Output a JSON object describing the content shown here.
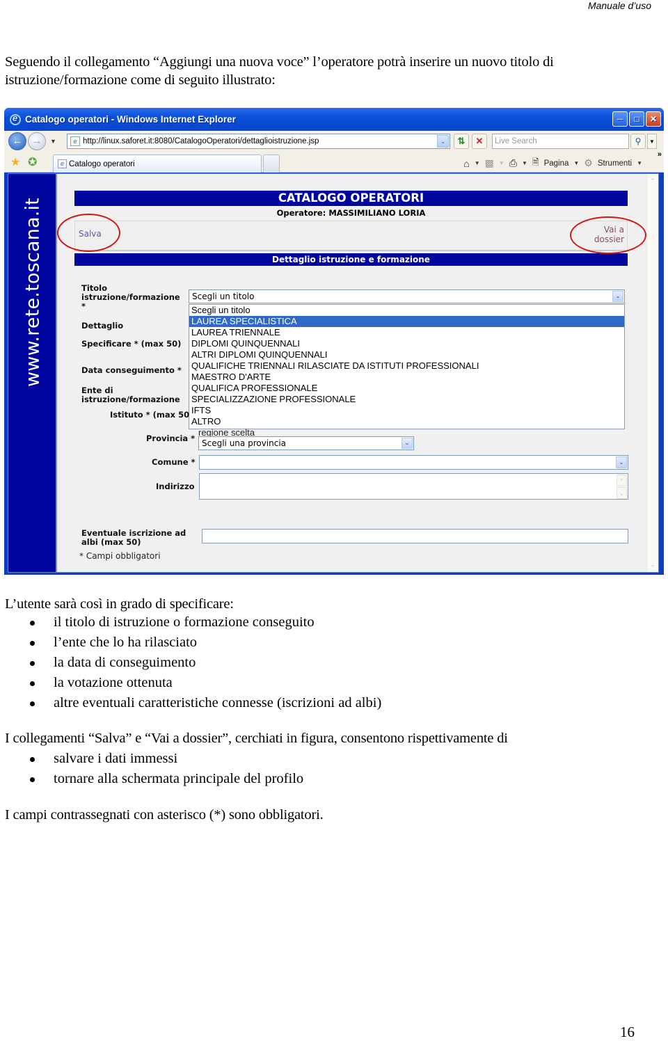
{
  "header": {
    "running_title": "Manuale d’uso"
  },
  "intro_text": "Seguendo il collegamento “Aggiungi una nuova voce” l’operatore potrà inserire un nuovo titolo di istruzione/formazione come di seguito illustrato:",
  "browser": {
    "window_title": "Catalogo operatori - Windows Internet Explorer",
    "address": "http://linux.saforet.it:8080/CatalogoOperatori/dettaglioistruzione.jsp",
    "search_placeholder": "Live Search",
    "tab_label": "Catalogo operatori",
    "command_bar": {
      "page_label": "Pagina",
      "tools_label": "Strumenti"
    },
    "icons": [
      "back-icon",
      "forward-icon",
      "refresh-icon",
      "stop-icon",
      "search-icon",
      "favorites-star-icon",
      "add-favorite-icon",
      "home-icon",
      "feeds-icon",
      "print-icon",
      "page-icon",
      "gear-icon"
    ]
  },
  "site": {
    "side_brand": "www.rete.toscana.it",
    "banner_title": "CATALOGO OPERATORI",
    "operator_line": "Operatore: MASSIMILIANO LORIA",
    "salva_link": "Salva",
    "dossier_link_line1": "Vai a",
    "dossier_link_line2": "dossier",
    "section_title": "Dettaglio istruzione e formazione",
    "form": {
      "titolo_label_1": "Titolo",
      "titolo_label_2": "istruzione/formazione",
      "titolo_label_3": "*",
      "titolo_selected": "Scegli un titolo",
      "titolo_options": [
        "Scegli un titolo",
        "LAUREA SPECIALISTICA",
        "LAUREA TRIENNALE",
        "DIPLOMI QUINQUENNALI",
        "ALTRI DIPLOMI QUINQUENNALI",
        "QUALIFICHE TRIENNALI RILASCIATE DA ISTITUTI PROFESSIONALI",
        "MAESTRO D'ARTE",
        "QUALIFICA PROFESSIONALE",
        "SPECIALIZZAZIONE PROFESSIONALE",
        "IFTS",
        "ALTRO"
      ],
      "highlighted_option": "LAUREA SPECIALISTICA",
      "dettaglio_label": "Dettaglio",
      "specificare_label": "Specificare * (max 50)",
      "data_label": "Data conseguimento *",
      "ente_label_1": "Ente di",
      "ente_label_2": "istruzione/formazione",
      "istituto_label": "Istituto * (max 50",
      "region_text": "regione scelta",
      "provincia_label": "Provincia *",
      "provincia_selected": "Scegli una provincia",
      "comune_label": "Comune *",
      "comune_value": "",
      "indirizzo_label": "Indirizzo",
      "indirizzo_value": "",
      "albi_label_1": "Eventuale iscrizione ad",
      "albi_label_2": "albi (max 50)",
      "albi_value": "",
      "required_note": "* Campi obbligatori"
    }
  },
  "body": {
    "specify_intro": "L’utente sarà così in grado di specificare:",
    "specify_items": [
      "il titolo di istruzione o formazione conseguito",
      "l’ente che lo ha rilasciato",
      "la data di conseguimento",
      "la votazione ottenuta",
      "altre eventuali caratteristiche connesse (iscrizioni ad albi)"
    ],
    "links_intro": "I collegamenti “Salva” e “Vai a dossier”, cerchiati in figura, consentono rispettivamente di",
    "links_items": [
      "salvare i dati immessi",
      "tornare alla schermata principale del profilo"
    ],
    "required_text": "I campi contrassegnati con asterisco (*) sono obbligatori."
  },
  "footer": {
    "page_number": "16"
  },
  "colors": {
    "banner_blue": "#00069d",
    "highlight_blue": "#316ac5",
    "annotation_red": "#d01818"
  }
}
